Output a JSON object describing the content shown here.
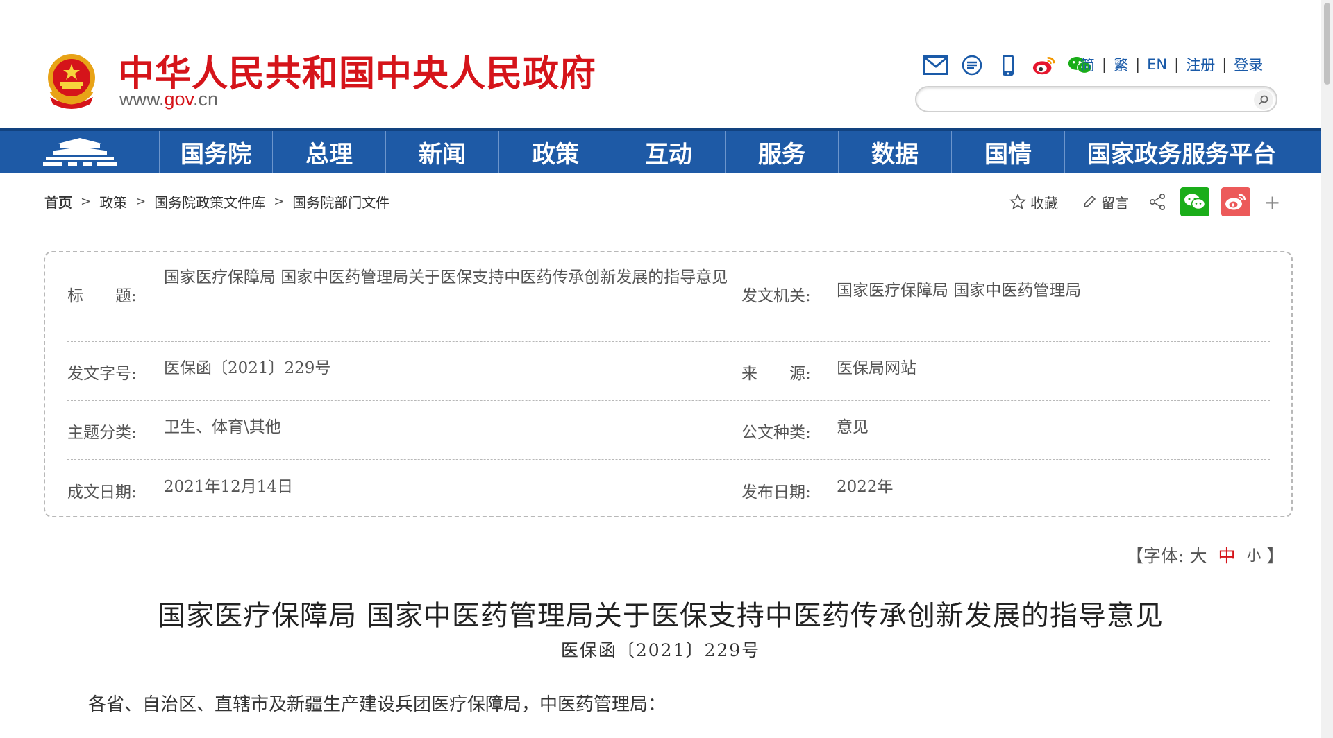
{
  "header": {
    "site_title": "中华人民共和国中央人民政府",
    "site_url_prefix": "www.",
    "site_url_accent": "gov",
    "site_url_suffix": ".cn",
    "icons": [
      "mail-icon",
      "message-icon",
      "mobile-icon",
      "weibo-icon",
      "wechat-icon"
    ],
    "links": {
      "simplified": "简",
      "traditional": "繁",
      "english": "EN",
      "register": "注册",
      "login": "登录"
    },
    "search": {
      "placeholder": ""
    }
  },
  "nav": {
    "items": [
      "国务院",
      "总理",
      "新闻",
      "政策",
      "互动",
      "服务",
      "数据",
      "国情",
      "国家政务服务平台"
    ],
    "colors": {
      "bar": "#1e5aa6",
      "title_red": "#d5141a"
    }
  },
  "breadcrumb": [
    "首页",
    "政策",
    "国务院政策文件库",
    "国务院部门文件"
  ],
  "share": {
    "favorite": "收藏",
    "comment": "留言",
    "more": "+"
  },
  "info": {
    "title_label": "标　　题:",
    "title_value": "国家医疗保障局  国家中医药管理局关于医保支持中医药传承创新发展的指导意见",
    "issuer_label": "发文机关:",
    "issuer_value": "国家医疗保障局  国家中医药管理局",
    "docno_label": "发文字号:",
    "docno_value": "医保函〔2021〕229号",
    "source_label": "来　　源:",
    "source_value": "医保局网站",
    "category_label": "主题分类:",
    "category_value": "卫生、体育\\其他",
    "doctype_label": "公文种类:",
    "doctype_value": "意见",
    "written_label": "成文日期:",
    "written_value": "2021年12月14日",
    "published_label": "发布日期:",
    "published_value": "2022年"
  },
  "font_size": {
    "open": "【字体:",
    "large": "大",
    "medium": "中",
    "small": "小",
    "close": "】"
  },
  "article": {
    "title": "国家医疗保障局  国家中医药管理局关于医保支持中医药传承创新发展的指导意见",
    "doc_number": "医保函〔2021〕229号",
    "greeting": "各省、自治区、直辖市及新疆生产建设兵团医疗保障局，中医药管理局："
  }
}
